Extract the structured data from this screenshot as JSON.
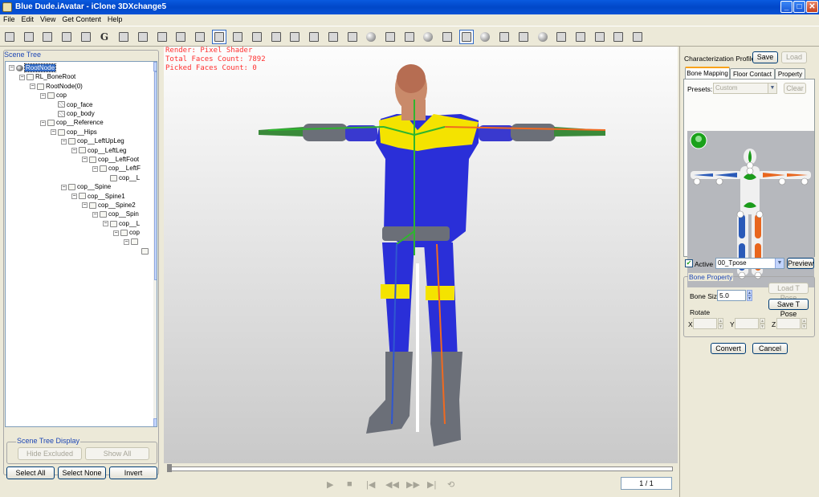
{
  "window": {
    "title": "Blue Dude.iAvatar - iClone 3DXchange5",
    "minimize": "_",
    "maximize": "□",
    "close": "✕"
  },
  "menu": [
    "File",
    "Edit",
    "View",
    "Get Content",
    "Help"
  ],
  "toolbar": {
    "icons": [
      "new-icon",
      "open-icon",
      "import-icon",
      "export-icon",
      "save-icon",
      "g-icon",
      "convert-icon",
      "undo-icon",
      "redo-icon",
      "home-icon",
      "move-down-icon",
      "move-icon",
      "rotate-icon",
      "pick-icon",
      "pan-icon",
      "orbit-icon",
      "scale-icon",
      "frame-icon",
      "grid-icon",
      "light-icon",
      "box-icon",
      "bone-icon",
      "sphere-icon",
      "joint-icon",
      "tpose-icon",
      "camera-icon",
      "skeleton-icon",
      "morph-icon",
      "sphere-shade-icon",
      "tool-icon",
      "cloud1-icon",
      "cloud2-icon",
      "export2-icon",
      "cart-icon"
    ],
    "g_label": "G"
  },
  "left": {
    "scene_tree_label": "Scene Tree",
    "tree": [
      {
        "label": "RootNode",
        "depth": 0,
        "icon": "globe",
        "expanded": true,
        "selected": true
      },
      {
        "label": "RL_BoneRoot",
        "depth": 1,
        "icon": "box",
        "expanded": true
      },
      {
        "label": "RootNode(0)",
        "depth": 2,
        "icon": "box",
        "expanded": true
      },
      {
        "label": "cop",
        "depth": 3,
        "icon": "box",
        "expanded": true
      },
      {
        "label": "cop_face",
        "depth": 4,
        "icon": "mesh"
      },
      {
        "label": "cop_body",
        "depth": 4,
        "icon": "mesh"
      },
      {
        "label": "cop__Reference",
        "depth": 3,
        "icon": "box",
        "expanded": true
      },
      {
        "label": "cop__Hips",
        "depth": 4,
        "icon": "box",
        "expanded": true
      },
      {
        "label": "cop__LeftUpLeg",
        "depth": 5,
        "icon": "box",
        "expanded": true
      },
      {
        "label": "cop__LeftLeg",
        "depth": 6,
        "icon": "box",
        "expanded": true
      },
      {
        "label": "cop__LeftFoot",
        "depth": 7,
        "icon": "box",
        "expanded": true
      },
      {
        "label": "cop__LeftF",
        "depth": 8,
        "icon": "box",
        "expanded": true
      },
      {
        "label": "cop__L",
        "depth": 9,
        "icon": "box"
      },
      {
        "label": "cop__Spine",
        "depth": 5,
        "icon": "box",
        "expanded": true
      },
      {
        "label": "cop__Spine1",
        "depth": 6,
        "icon": "box",
        "expanded": true
      },
      {
        "label": "cop__Spine2",
        "depth": 7,
        "icon": "box",
        "expanded": true
      },
      {
        "label": "cop__Spin",
        "depth": 8,
        "icon": "box",
        "expanded": true
      },
      {
        "label": "cop__L",
        "depth": 9,
        "icon": "box",
        "expanded": true
      },
      {
        "label": "cop",
        "depth": 10,
        "icon": "box",
        "expanded": true
      },
      {
        "label": "",
        "depth": 11,
        "icon": "box",
        "expanded": true
      },
      {
        "label": "",
        "depth": 12,
        "icon": "box"
      }
    ],
    "scene_tree_display_label": "Scene Tree Display",
    "hide_excluded": "Hide Excluded",
    "show_all": "Show All",
    "select_all": "Select All",
    "select_none": "Select None",
    "invert": "Invert"
  },
  "viewport": {
    "render_line": "Render: Pixel Shader",
    "faces_line": "Total Faces Count: 7892",
    "picked_line": "Picked Faces Count: 0"
  },
  "timeline": {
    "frame": "1 / 1",
    "controls": [
      "play-icon",
      "stop-icon",
      "prev-key-icon",
      "rewind-icon",
      "forward-icon",
      "next-key-icon",
      "loop-icon"
    ],
    "glyphs": [
      "▶",
      "■",
      "|◀",
      "◀◀",
      "▶▶",
      "▶|",
      "⟲"
    ]
  },
  "right": {
    "profile_label": "Characterization Profile",
    "save": "Save",
    "load": "Load",
    "tabs": [
      "Bone Mapping",
      "Floor Contact",
      "Property"
    ],
    "presets_label": "Presets:",
    "presets_value": "Custom",
    "clear": "Clear",
    "active_label": "Active",
    "pose_value": "00_Tpose",
    "preview": "Preview",
    "bone_property_label": "Bone Property",
    "load_tpose": "Load T Pose",
    "save_tpose": "Save T Pose",
    "bone_size_label": "Bone Size",
    "bone_size_value": "5.0",
    "rotate_label": "Rotate",
    "x_label": "X",
    "y_label": "Y",
    "z_label": "Z",
    "convert": "Convert",
    "cancel": "Cancel"
  },
  "colors": {
    "accent_blue": "#316ac5",
    "suit_blue": "#2a2fd8",
    "suit_yellow": "#ffee00",
    "bone_green": "#2fb52f",
    "bone_orange": "#f06a20",
    "status_red": "#ff3030"
  }
}
